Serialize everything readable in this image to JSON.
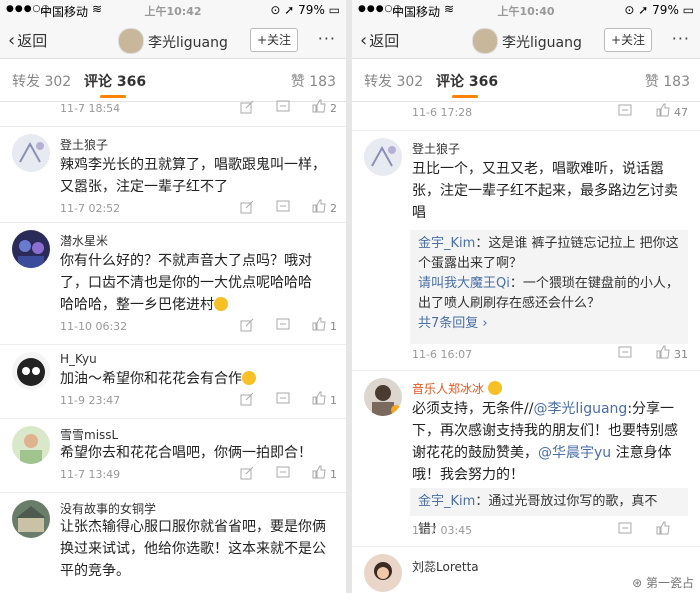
{
  "left": {
    "status": {
      "carrier": "中国移动",
      "time": "上午10:42",
      "battery": "79%"
    },
    "nav": {
      "back": "返回",
      "title": "李光liguang",
      "follow": "+关注",
      "more": "···"
    },
    "tabs": {
      "repost": "转发 302",
      "comment": "评论 366",
      "like": "赞 183"
    },
    "top_row": {
      "time": "11-7 18:54",
      "likes": "2"
    },
    "comments": [
      {
        "name": "登土狼子",
        "lines": [
          "辣鸡李光长的丑就算了，唱歌跟鬼叫一样，",
          "又嚣张，注定一辈子红不了"
        ],
        "time": "11-7 02:52",
        "likes": "2"
      },
      {
        "name": "潜水星米",
        "lines": [
          "你有什么好的？不就声音大了点吗？哦对",
          "了，口齿不清也是你的一大优点呢哈哈哈",
          "哈哈哈，整一乡巴佬进村"
        ],
        "time": "11-10 06:32",
        "likes": "1"
      },
      {
        "name": "H_Kyu",
        "lines": [
          "加油～希望你和花花会有合作"
        ],
        "time": "11-9 23:47",
        "likes": "1"
      },
      {
        "name": "雪雪missL",
        "lines": [
          "希望你去和花花合唱吧，你俩一拍即合！"
        ],
        "time": "11-7 13:49",
        "likes": "1"
      },
      {
        "name": "没有故事的女铜学",
        "lines": [
          "让张杰输得心服口服你就省省吧，要是你俩",
          "换过来试试，他给你选歌！这本来就不是公",
          "平的竞争。"
        ],
        "time": "",
        "likes": ""
      }
    ]
  },
  "right": {
    "status": {
      "carrier": "中国移动",
      "time": "上午10:40",
      "battery": "79%"
    },
    "nav": {
      "back": "返回",
      "title": "李光liguang",
      "follow": "+关注",
      "more": "···"
    },
    "tabs": {
      "repost": "转发 302",
      "comment": "评论 366",
      "like": "赞 183"
    },
    "top_row": {
      "time": "11-6 17:28",
      "likes": "47"
    },
    "c1": {
      "name": "登土狼子",
      "lines": [
        "丑比一个，又丑又老，唱歌难听，说话嚣",
        "张，注定一辈子红不起来，最多路边乞讨卖",
        "唱"
      ],
      "replies": [
        {
          "user": "金宇_Kim",
          "text": "：这是谁 裤子拉链忘记拉上 把你这",
          "text2": "个蛋露出来了啊？"
        },
        {
          "user": "请叫我大魔王Qi",
          "text": "：一个猥琐在键盘前的小人，",
          "text2": "出了喷人刷刷存在感还会什么？"
        }
      ],
      "more_replies": "共7条回复 ›",
      "time": "11-6 16:07",
      "likes": "31"
    },
    "c2": {
      "name": "音乐人郑冰冰",
      "l1a": "必须支持，无条件//",
      "l1b": "@李光liguang",
      "l1c": ":分享一",
      "l2": "下，再次感谢支持我的朋友们！也要特别感",
      "l3a": "谢花花的鼓励赞美，",
      "l3b": "@华晨宇yu",
      "l3c": " 注意身体",
      "l4": "哦！我会努力的！",
      "reply_user": "金宇_Kim",
      "reply_text": "：通过光哥放过你写的歌，真不错！",
      "time": "11-7 03:45"
    },
    "c3": {
      "name": "刘蕊Loretta"
    },
    "watermark": "第一瓷占"
  }
}
